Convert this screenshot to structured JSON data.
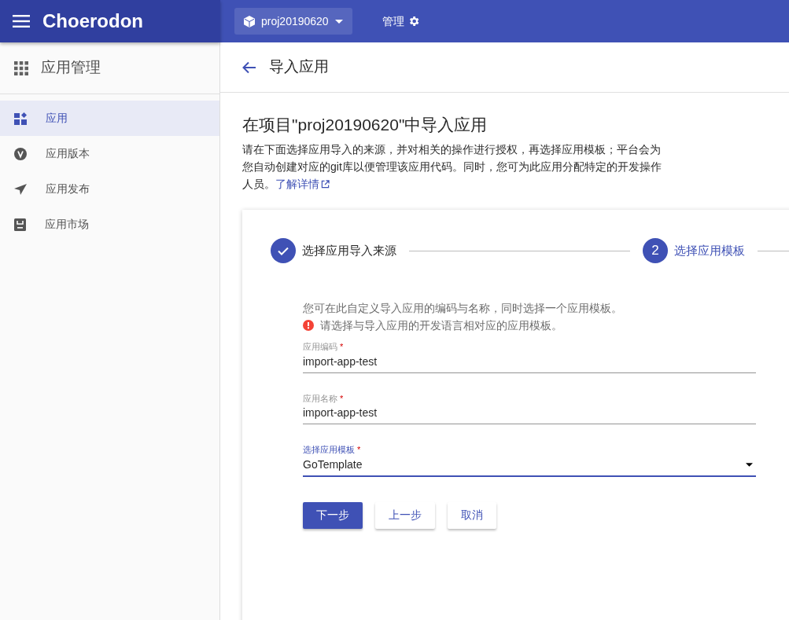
{
  "header": {
    "brand": "Choerodon",
    "project": "proj20190620",
    "manage": "管理"
  },
  "sidebar": {
    "title": "应用管理",
    "items": [
      {
        "label": "应用",
        "selected": true
      },
      {
        "label": "应用版本",
        "selected": false
      },
      {
        "label": "应用发布",
        "selected": false
      },
      {
        "label": "应用市场",
        "selected": false
      }
    ]
  },
  "page": {
    "title": "导入应用",
    "heading": "在项目\"proj20190620\"中导入应用",
    "description": "请在下面选择应用导入的来源，并对相关的操作进行授权，再选择应用模板；平台会为您自动创建对应的git库以便管理该应用代码。同时，您可为此应用分配特定的开发操作人员。",
    "learn_more": "了解详情"
  },
  "steps": [
    {
      "label": "选择应用导入来源",
      "completed": true,
      "selected": false
    },
    {
      "label": "选择应用模板",
      "number": "2",
      "completed": false,
      "selected": true
    }
  ],
  "step_intro": "您可在此自定义导入应用的编码与名称，同时选择一个应用模板。",
  "warning": "请选择与导入应用的开发语言相对应的应用模板。",
  "fields": [
    {
      "kind": "text",
      "label": "应用编码",
      "required_mark": "*",
      "value": "import-app-test",
      "focused": false
    },
    {
      "kind": "text",
      "label": "应用名称",
      "required_mark": "*",
      "value": "import-app-test",
      "focused": false
    },
    {
      "kind": "select",
      "label": "选择应用模板",
      "required_mark": "*",
      "value": "GoTemplate",
      "focused": true
    }
  ],
  "buttons": [
    {
      "label": "下一步",
      "kind": "primary"
    },
    {
      "label": "上一步",
      "kind": "default"
    },
    {
      "label": "取消",
      "kind": "default"
    }
  ]
}
